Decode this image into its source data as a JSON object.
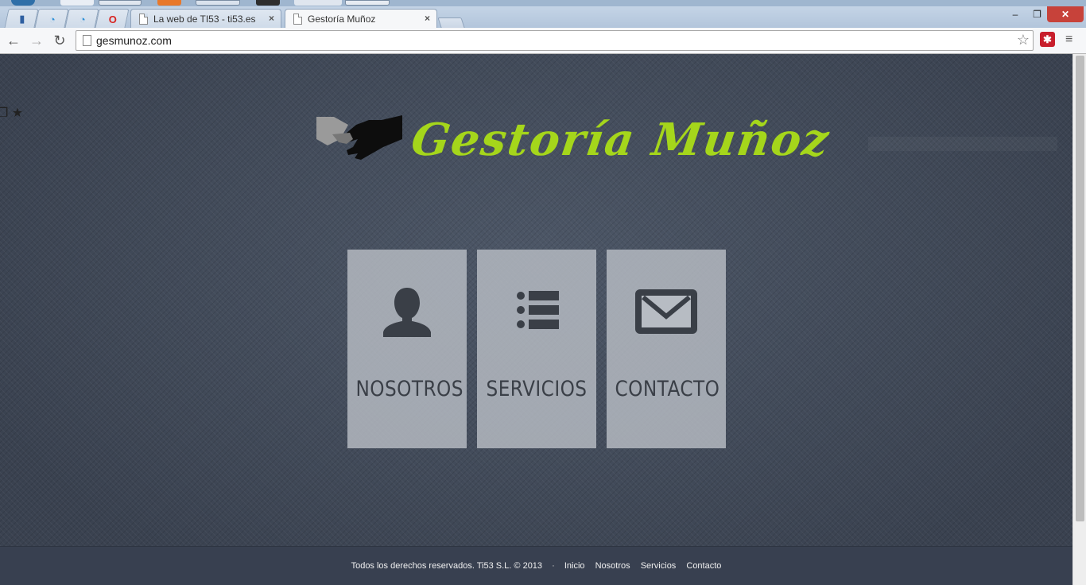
{
  "browser": {
    "tabs": [
      {
        "title": "La web de TI53 - ti53.es",
        "close": "×"
      },
      {
        "title": "Gestoría Muñoz",
        "close": "×"
      }
    ],
    "pinned_icons": [
      "bookmark-icon",
      "app-icon",
      "app-icon",
      "opera-icon"
    ],
    "window_controls": {
      "minimize": "‒",
      "maximize": "❐",
      "close": "✕"
    },
    "back": "←",
    "forward": "→",
    "reload": "↻",
    "url": "gesmunoz.com",
    "bookmark_star": "☆",
    "extension_glyph": "✱",
    "menu": "≡"
  },
  "page": {
    "edge_glyphs": "❐ ★",
    "brand": "Gestoría Muñoz",
    "tiles": [
      {
        "label": "NOSOTROS",
        "icon": "user-icon"
      },
      {
        "label": "SERVICIOS",
        "icon": "list-icon"
      },
      {
        "label": "CONTACTO",
        "icon": "envelope-icon"
      }
    ],
    "footer": {
      "copyright": "Todos los derechos reservados. Ti53 S.L. © 2013",
      "separator": "·",
      "links": [
        "Inicio",
        "Nosotros",
        "Servicios",
        "Contacto"
      ]
    }
  },
  "colors": {
    "brand": "#a5d61b",
    "tile_bg": "#b8bdc4",
    "tile_icon": "#3a3f47",
    "page_bg": "#404957",
    "footer_bg": "#384050"
  }
}
